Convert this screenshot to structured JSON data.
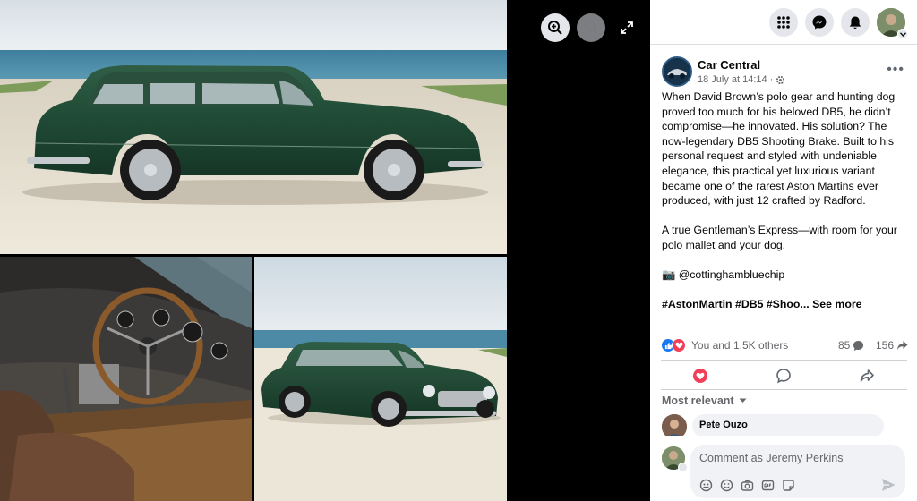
{
  "post": {
    "page_name": "Car Central",
    "date": "18 July at 14:14",
    "dot": "·",
    "paragraph_1": "When David Brown’s polo gear and hunting dog proved too much for his beloved DB5, he didn’t compromise—he innovated. His solution? The now-legendary DB5 Shooting Brake. Built to his personal request and styled with undeniable elegance, this practical yet luxurious variant became one of the rarest Aston Martins ever produced, with just 12 crafted by Radford.",
    "paragraph_2": "A true Gentleman’s Express—with room for your polo mallet and your dog.",
    "credit": "📷 @cottinghambluechip",
    "hashtags": "#AstonMartin #DB5 #Shoo...",
    "see_more": "See more",
    "more_label": "•••"
  },
  "reactions": {
    "summary": "You and 1.5K others",
    "comments": "85",
    "shares": "156"
  },
  "comments_section": {
    "sort_label": "Most relevant",
    "first_commenter": "Pete Ouzo"
  },
  "composer": {
    "placeholder": "Comment as Jeremy Perkins"
  },
  "icons": {
    "topbar": [
      "menu-grid-icon",
      "messenger-icon",
      "bell-icon"
    ],
    "viewer": [
      "zoom-in-icon",
      "zoom-out-icon",
      "expand-icon"
    ],
    "actions": [
      "love-icon",
      "comment-icon",
      "share-icon"
    ],
    "composer_tools": [
      "avatar-sticker-icon",
      "emoji-icon",
      "camera-icon",
      "gif-icon",
      "sticker-icon"
    ]
  },
  "colors": {
    "link_blue": "#1877f2",
    "love_red": "#f33e58",
    "car_green": "#1f4a35"
  }
}
